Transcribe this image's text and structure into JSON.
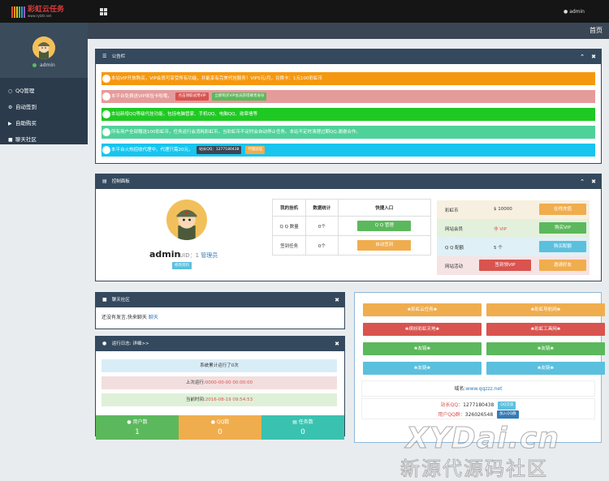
{
  "topbar": {
    "logo_text": "彩虹云任务",
    "logo_sub": "www.rytztr.net",
    "user_label": "admin"
  },
  "sidebar": {
    "username": "admin",
    "items": [
      {
        "label": "QQ管理",
        "icon": "globe-icon"
      },
      {
        "label": "自动签到",
        "icon": "gear-icon"
      },
      {
        "label": "自助购买",
        "icon": "cart-icon"
      },
      {
        "label": "聊天社区",
        "icon": "chat-icon"
      }
    ]
  },
  "breadcrumb": "首页",
  "notices": {
    "title": "公告栏",
    "items": [
      {
        "text": "本站VIP开放购买，VIP会员可享受所有功能，并能享有完美代挂服务！VIP5元/月，兑换卡：1元100彩虹币",
        "color": "#f39c12"
      },
      {
        "text": "本平台免费送VIP体验卡啦哦，",
        "btn1": "点击领取试用VIP",
        "btn2": "立即购买VIP会员获得尊贵身份",
        "color": "#e8a0a0"
      },
      {
        "text": "本站新增QQ等级代挂功能，包括电脑管家、手机QQ、电脑QQ、勋章墙等",
        "color": "#2ecc40"
      },
      {
        "text": "所有用户全部赠送100彩虹币，任务运行会消耗彩虹币，当彩虹币不足时会自动停止任务。本站不定时清理过期QQ,谢谢合作。",
        "color": "#4fcf9f"
      },
      {
        "text": "本平台火热招收代理中，代理只需20元，",
        "btn1": "站长QQ：1277180438",
        "btn2": "代理验证",
        "color": "#21c9f2"
      }
    ]
  },
  "control_panel": {
    "title": "控制面板",
    "username": "admin",
    "uid_text": "UID：1",
    "role": "管理员",
    "edit_label": "修改资料",
    "table": {
      "headers": [
        "我的挂机",
        "数据统计",
        "快捷入口"
      ],
      "rows": [
        {
          "label": "Q Q 数量",
          "value": "0个",
          "button": "Q Q 管理"
        },
        {
          "label": "签到任务",
          "value": "0个",
          "button": "自动签到"
        }
      ]
    },
    "vip_rows": [
      {
        "label": "彩虹币",
        "value": "$ 10000",
        "button": "在线充值",
        "color": "#f7f0e0",
        "btn_color": "#f0ad4e"
      },
      {
        "label": "网站会员",
        "value": "非 VIP",
        "button": "购买VIP",
        "color": "#e3f1dc",
        "btn_color": "#5cb85c"
      },
      {
        "label": "Q Q 配额",
        "value": "5 个",
        "button": "购买配额",
        "color": "#dff0f6",
        "btn_color": "#5bc0de"
      },
      {
        "label": "网站活动",
        "value": "签到领VIP",
        "button": "邀请好友",
        "color": "#f6e3e3",
        "btn_color": "#f0ad4e"
      }
    ]
  },
  "chat": {
    "title": "聊天社区",
    "text": "还没有发言,快来聊天",
    "link": "聊天"
  },
  "runlog": {
    "title": "运行日志: 详细>>",
    "rows": [
      {
        "text": "系统累计运行了0次"
      },
      {
        "text": "上次运行:",
        "value": "0000-00-00 00:00:00"
      },
      {
        "text": "当前时间:",
        "value": "2016-08-19 09:54:53"
      }
    ],
    "stats": [
      {
        "label": "用户数",
        "value": "1",
        "icon": "user-icon",
        "color": "#5cb85c"
      },
      {
        "label": "QQ数",
        "value": "0",
        "icon": "qq-icon",
        "color": "#f0ad4e"
      },
      {
        "label": "任务数",
        "value": "0",
        "icon": "list-icon",
        "color": "#3ac2b0"
      }
    ]
  },
  "links_panel": {
    "buttons": [
      {
        "label": "❀彩虹云任务❀",
        "color": "#f0ad4e"
      },
      {
        "label": "❀彩虹导航网❀",
        "color": "#f0ad4e"
      },
      {
        "label": "❀缤纷彩虹天地❀",
        "color": "#d9534f"
      },
      {
        "label": "❀彩虹工具网❀",
        "color": "#d9534f"
      },
      {
        "label": "❀友链❀",
        "color": "#5cb85c"
      },
      {
        "label": "❀友链❀",
        "color": "#5cb85c"
      },
      {
        "label": "❀友链❀",
        "color": "#5bc0de"
      },
      {
        "label": "❀友链❀",
        "color": "#5bc0de"
      }
    ],
    "domain_label": "域名:",
    "domain": "www.qqzzz.net",
    "admin_qq_label": "站长QQ：",
    "admin_qq": "1277180438",
    "qq_btn": "QQ交谈",
    "group_label": "用户QQ群：",
    "group_qq": "326026548",
    "group_btn": "加入QQ群"
  },
  "watermark": {
    "line1": "XYDai.cn",
    "line2": "新源代源码社区"
  }
}
